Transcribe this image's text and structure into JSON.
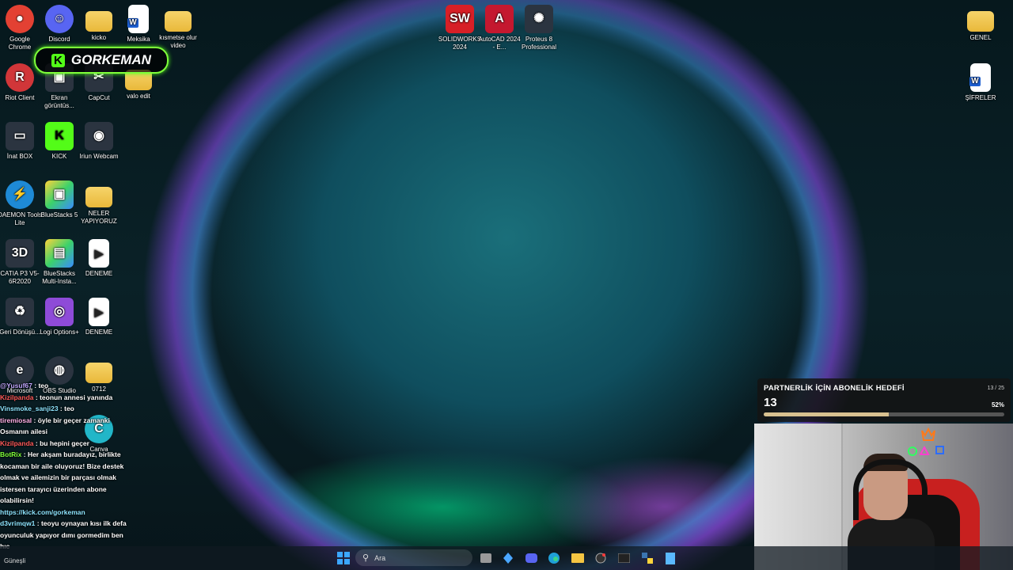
{
  "desktop_icons": [
    {
      "label": "Google Chrome",
      "icon": "chrome-icon",
      "color": "#e34133"
    },
    {
      "label": "Discord",
      "icon": "discord-icon",
      "color": "#5865f2"
    },
    {
      "label": "kicko",
      "icon": "folder-icon"
    },
    {
      "label": "Meksika",
      "icon": "word-document-icon"
    },
    {
      "label": "kısmetse olur video",
      "icon": "folder-icon"
    },
    {
      "label": "Riot Client",
      "icon": "riot-icon",
      "color": "#d13639"
    },
    {
      "label": "Ekran görüntüs...",
      "icon": "screenshot-icon"
    },
    {
      "label": "CapCut",
      "icon": "capcut-icon"
    },
    {
      "label": "valo edit",
      "icon": "folder-icon"
    },
    {
      "label": "İnat BOX",
      "icon": "tv-icon"
    },
    {
      "label": "KICK",
      "icon": "kick-icon",
      "color": "#53fc18"
    },
    {
      "label": "Iriun Webcam",
      "icon": "webcam-icon"
    },
    {
      "label": "DAEMON Tools Lite",
      "icon": "daemon-icon",
      "color": "#1e8ad6"
    },
    {
      "label": "BlueStacks 5",
      "icon": "bluestacks-icon"
    },
    {
      "label": "NELER YAPIYORUZ",
      "icon": "folder-icon"
    },
    {
      "label": "CATIA P3 V5-6R2020",
      "icon": "catia-icon"
    },
    {
      "label": "BlueStacks Multi-Insta...",
      "icon": "bluestacks-multi-icon"
    },
    {
      "label": "DENEME",
      "icon": "video-file-icon"
    },
    {
      "label": "Geri Dönüşü...",
      "icon": "recycle-bin-icon"
    },
    {
      "label": "Logi Options+",
      "icon": "logi-icon",
      "color": "#8e4bd8"
    },
    {
      "label": "DENEME",
      "icon": "video-file-icon"
    },
    {
      "label": "Microsoft",
      "icon": "edge-icon"
    },
    {
      "label": "OBS Studio",
      "icon": "obs-icon"
    },
    {
      "label": "0712",
      "icon": "folder-icon"
    },
    {
      "label": "Canva",
      "icon": "canva-icon",
      "color": "#22b6c8"
    },
    {
      "label": "SOLIDWORKS 2024",
      "icon": "solidworks-icon",
      "color": "#d71f26"
    },
    {
      "label": "AutoCAD 2024 - E...",
      "icon": "autocad-icon",
      "color": "#c4182f"
    },
    {
      "label": "Proteus 8 Professional",
      "icon": "proteus-icon"
    },
    {
      "label": "GENEL",
      "icon": "folder-icon"
    },
    {
      "label": "ŞİFRELER",
      "icon": "word-document-icon"
    }
  ],
  "overlay_brand": {
    "letter": "K",
    "name": "GORKEMAN"
  },
  "chat": [
    {
      "user": "@Yusuf67",
      "text": ": teo"
    },
    {
      "user": "Kizilpanda",
      "text": ": teonun annesi yanında"
    },
    {
      "user": "Vinsmoke_sanji23",
      "text": ": teo"
    },
    {
      "user": "tiremiosal",
      "text": ": öyle bir geçer zamanki Osmanın ailesi"
    },
    {
      "user": "Kizilpanda",
      "text": ": bu hepini geçer"
    },
    {
      "user": "BotRix",
      "text": ": Her akşam buradayız, birlikte kocaman bir aile oluyoruz! Bize destek olmak ve ailemizin bir parçası olmak istersen tarayıcı üzerinden abone olabilirsin!"
    },
    {
      "user": "",
      "text": "https://kick.com/gorkeman"
    },
    {
      "user": "d3vrimqw1",
      "text": ": teoyu oynayan kısı ilk defa oyunculuk yapıyor dımı gormedim ben hıc"
    }
  ],
  "goal": {
    "title": "PARTNERLİK İÇİN ABONELİK HEDEFİ",
    "current": "13",
    "ratio": "13 / 25",
    "percent_label": "52%",
    "progress": 0.52
  },
  "taskbar": {
    "search_placeholder": "Ara",
    "weather_text": "Güneşli",
    "items": [
      "start-icon",
      "search",
      "task-view-icon",
      "app-icon",
      "discord-icon",
      "edge-icon",
      "file-explorer-icon",
      "steam-icon",
      "terminal-icon",
      "python-icon",
      "notepad-icon"
    ]
  }
}
